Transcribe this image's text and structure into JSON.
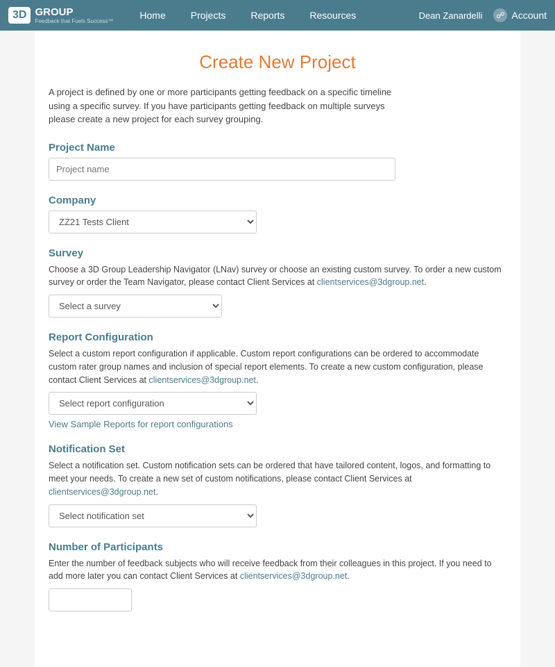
{
  "nav": {
    "logo_text": "3D",
    "logo_sub": "Feedback that Fuels Success™",
    "group_label": "GROUP",
    "links": [
      "Home",
      "Projects",
      "Reports",
      "Resources"
    ],
    "user_name": "Dean Zanardelli",
    "account_label": "Account"
  },
  "page": {
    "title": "Create New Project",
    "intro": "A project is defined by one or more participants getting feedback on a specific timeline using a specific survey. If you have participants getting feedback on multiple surveys please create a new project for each survey grouping.",
    "sections": {
      "project_name": {
        "label": "Project Name",
        "placeholder": "Project name"
      },
      "company": {
        "label": "Company",
        "selected": "ZZ21 Tests Client",
        "options": [
          "ZZ21 Tests Client"
        ]
      },
      "survey": {
        "label": "Survey",
        "desc_part1": "Choose a 3D Group Leadership Navigator (LNav) survey or choose an existing custom survey. To order a new custom survey or order the Team Navigator, please contact Client Services at ",
        "email": "clientservices@3dgroup.net",
        "desc_part2": ".",
        "placeholder": "Select a survey",
        "options": [
          "Select a survey"
        ]
      },
      "report_config": {
        "label": "Report Configuration",
        "desc_part1": "Select a custom report configuration if applicable. Custom report configurations can be ordered to accommodate custom rater group names and inclusion of special report elements. To create a new custom configuration, please contact Client Services at ",
        "email": "clientservices@3dgroup.net",
        "desc_part2": ".",
        "placeholder": "Select report configuration",
        "options": [
          "Select report configuration"
        ],
        "sample_link": "View Sample Reports for report configurations"
      },
      "notification_set": {
        "label": "Notification Set",
        "desc_part1": "Select a notification set. Custom notification sets can be ordered that have tailored content, logos, and formatting to meet your needs. To create a new set of custom notifications, please contact Client Services at ",
        "email": "clientservices@3dgroup.net",
        "desc_part2": ".",
        "placeholder": "Select notification set",
        "options": [
          "Select notification set"
        ]
      },
      "participants": {
        "label": "Number of Participants",
        "desc_part1": "Enter the number of feedback subjects who will receive feedback from their colleagues in this project. If you need to add more later you can contact Client Services at ",
        "email": "clientservices@3dgroup.net",
        "desc_part2": "."
      }
    }
  }
}
